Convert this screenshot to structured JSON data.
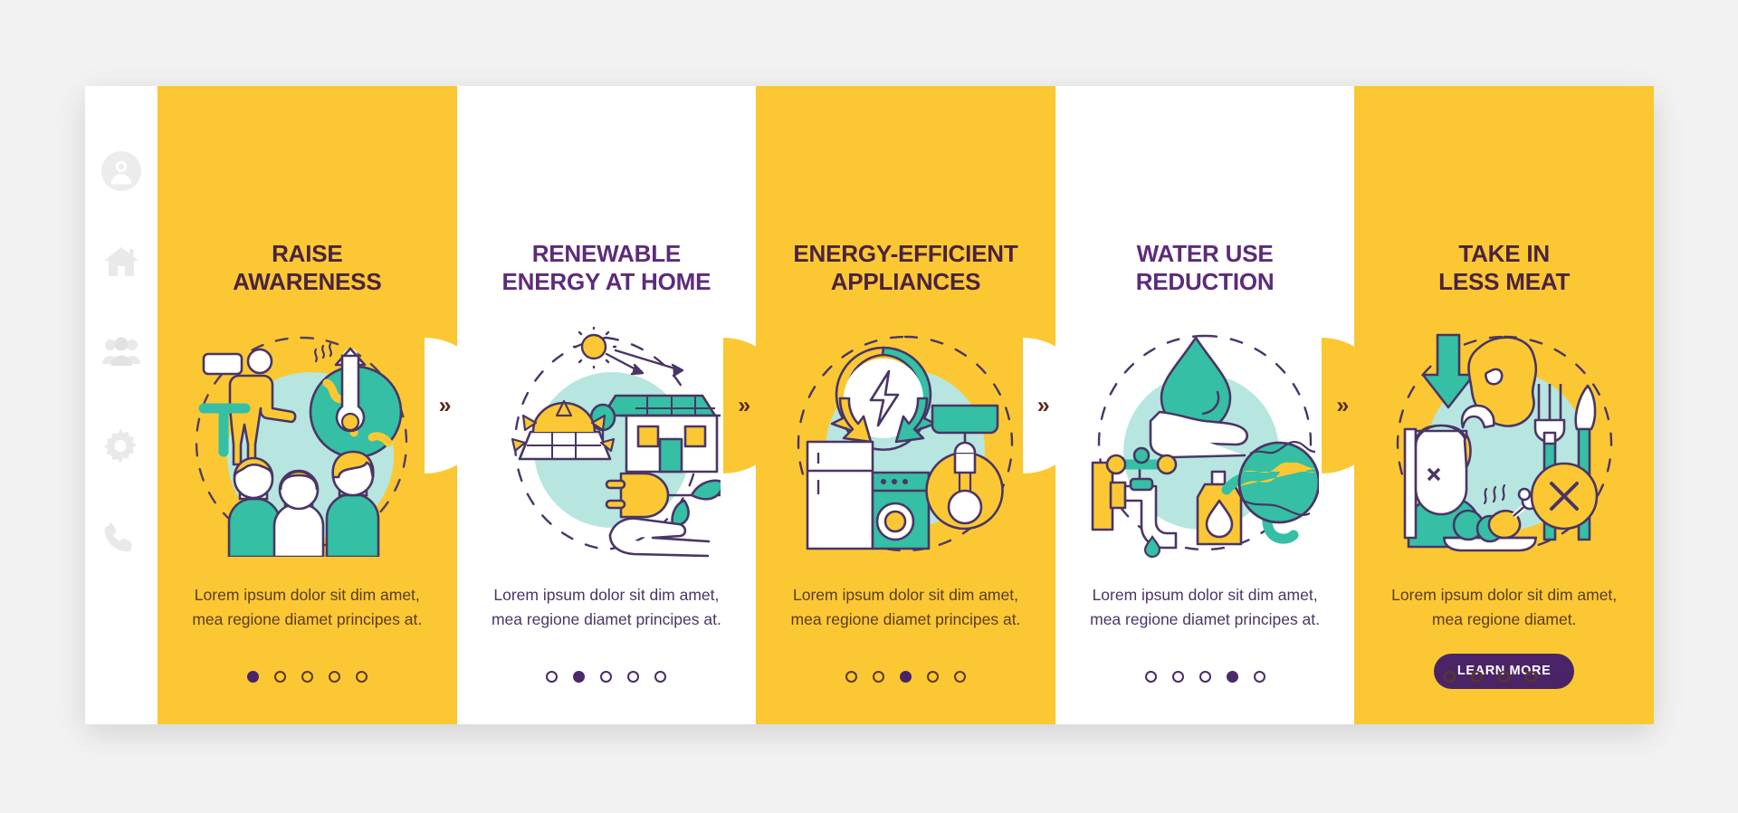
{
  "app": {
    "background_color": "#f2f2f2",
    "accent_yellow": "#fbc833",
    "accent_purple": "#4a2466",
    "accent_teal": "#3fc4ac",
    "title_purple": "#5c2b7a",
    "title_dark": "#4a2340"
  },
  "sidebar": {
    "items": [
      {
        "icon": "user-avatar-icon",
        "label": "Profile"
      },
      {
        "icon": "home-icon",
        "label": "Home"
      },
      {
        "icon": "people-group-icon",
        "label": "Community"
      },
      {
        "icon": "gear-icon",
        "label": "Settings"
      },
      {
        "icon": "phone-icon",
        "label": "Contact"
      }
    ]
  },
  "separator": {
    "glyph": "»"
  },
  "screens": [
    {
      "id": "raise-awareness",
      "theme": "yellow",
      "title": "RAISE\nAWARENESS",
      "title_line1": "RAISE",
      "title_line2": "AWARENESS",
      "illustration": "people-globe-thermometer-illustration",
      "body": "Lorem ipsum dolor sit dim amet, mea regione diamet principes at.",
      "cta": null,
      "dots": {
        "count": 5,
        "active": 1
      }
    },
    {
      "id": "renewable-energy-at-home",
      "theme": "white",
      "title": "RENEWABLE\nENERGY AT HOME",
      "title_line1": "RENEWABLE",
      "title_line2": "ENERGY AT HOME",
      "illustration": "solar-panel-house-plug-illustration",
      "body": "Lorem ipsum dolor sit dim amet, mea regione diamet principes at.",
      "cta": null,
      "dots": {
        "count": 5,
        "active": 2
      }
    },
    {
      "id": "energy-efficient-appliances",
      "theme": "yellow",
      "title": "ENERGY-EFFICIENT\nAPPLIANCES",
      "title_line1": "ENERGY-EFFICIENT",
      "title_line2": "APPLIANCES",
      "illustration": "fridge-washer-bulb-recycle-illustration",
      "body": "Lorem ipsum dolor sit dim amet, mea regione diamet principes at.",
      "cta": null,
      "dots": {
        "count": 5,
        "active": 3
      }
    },
    {
      "id": "water-use-reduction",
      "theme": "white",
      "title": "WATER USE\nREDUCTION",
      "title_line1": "WATER USE",
      "title_line2": "REDUCTION",
      "illustration": "faucet-waterdrop-globe-illustration",
      "body": "Lorem ipsum dolor sit dim amet, mea regione diamet principes at.",
      "cta": null,
      "dots": {
        "count": 5,
        "active": 4
      }
    },
    {
      "id": "take-in-less-meat",
      "theme": "yellow",
      "title": "TAKE IN\nLESS MEAT",
      "title_line1": "TAKE IN",
      "title_line2": "LESS MEAT",
      "illustration": "meat-cutlery-person-illustration",
      "body": "Lorem ipsum dolor sit dim amet, mea regione diamet.",
      "cta": "LEARN MORE",
      "dots": {
        "count": 5,
        "active": 5
      }
    }
  ]
}
